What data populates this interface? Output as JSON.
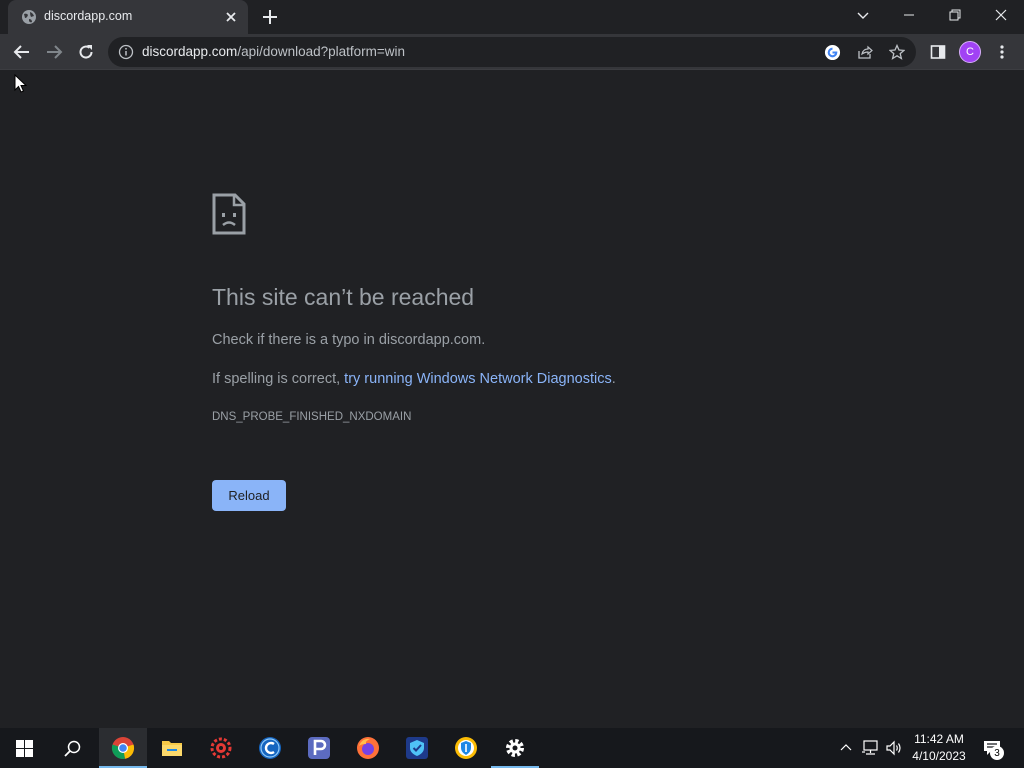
{
  "browser": {
    "tab": {
      "title": "discordapp.com"
    },
    "address": {
      "host": "discordapp.com",
      "path": "/api/download?platform=win"
    },
    "profile_initial": "C"
  },
  "page": {
    "heading": "This site can’t be reached",
    "typo_prefix": "Check if there is a typo in ",
    "typo_host": "discordapp.com",
    "typo_suffix": ".",
    "spelling_prefix": "If spelling is correct, ",
    "diagnostics_link": "try running Windows Network Diagnostics",
    "spelling_suffix": ".",
    "error_code": "DNS_PROBE_FINISHED_NXDOMAIN",
    "reload_label": "Reload"
  },
  "taskbar": {
    "apps": [
      "start",
      "search",
      "chrome",
      "file-explorer",
      "settings-gear-red",
      "ccleaner",
      "p-app",
      "firefox",
      "security-shield",
      "brave",
      "settings"
    ],
    "time": "11:42 AM",
    "date": "4/10/2023",
    "notification_count": "3"
  },
  "colors": {
    "link": "#8ab4f8",
    "button": "#8ab4f8",
    "background": "#202124",
    "avatar": "#a142f4"
  }
}
